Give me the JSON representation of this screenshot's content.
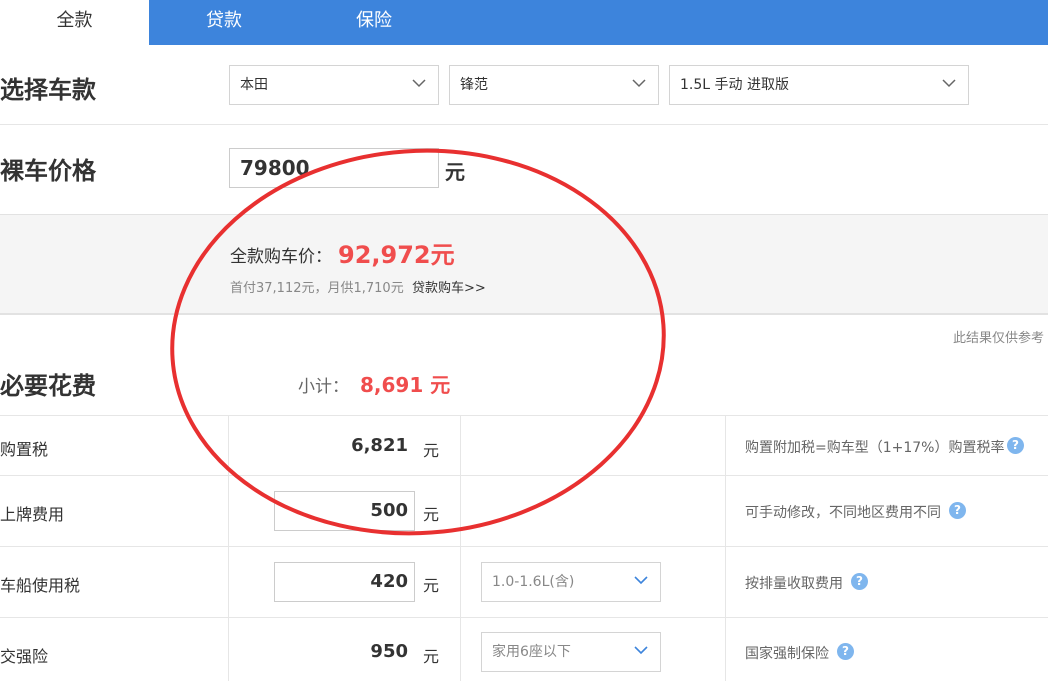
{
  "tabs": [
    {
      "label": "全款"
    },
    {
      "label": "贷款"
    },
    {
      "label": "保险"
    }
  ],
  "car_select": {
    "title": "选择车款",
    "brand": "本田",
    "model": "锋范",
    "version": "1.5L 手动 进取版"
  },
  "price": {
    "title": "裸车价格",
    "value": "79800",
    "unit": "元"
  },
  "summary": {
    "total_label": "全款购车价：",
    "total_value": "92,972元",
    "detail": "首付37,112元，月供1,710元",
    "loan_link": "贷款购车>>"
  },
  "note": "此结果仅供参考",
  "required": {
    "title": "必要花费",
    "subtotal_label": "小计：",
    "subtotal_value": "8,691 元",
    "rows": [
      {
        "label": "购置税",
        "value": "6,821",
        "unit": "元",
        "desc": "购置附加税=购车型（1+17%）购置税率"
      },
      {
        "label": "上牌费用",
        "value": "500",
        "unit": "元",
        "desc": "可手动修改，不同地区费用不同"
      },
      {
        "label": "车船使用税",
        "value": "420",
        "unit": "元",
        "option": "1.0-1.6L(含)",
        "desc": "按排量收取费用"
      },
      {
        "label": "交强险",
        "value": "950",
        "unit": "元",
        "option": "家用6座以下",
        "desc": "国家强制保险"
      }
    ]
  },
  "icons": {
    "chevron": "chevron-down-icon",
    "help": "question-mark-icon",
    "help_glyph": "?"
  },
  "colors": {
    "tab_bar": "#3d84dc",
    "highlight": "#f04d4d",
    "help": "#7fb6ee",
    "annotation": "#e83030"
  }
}
